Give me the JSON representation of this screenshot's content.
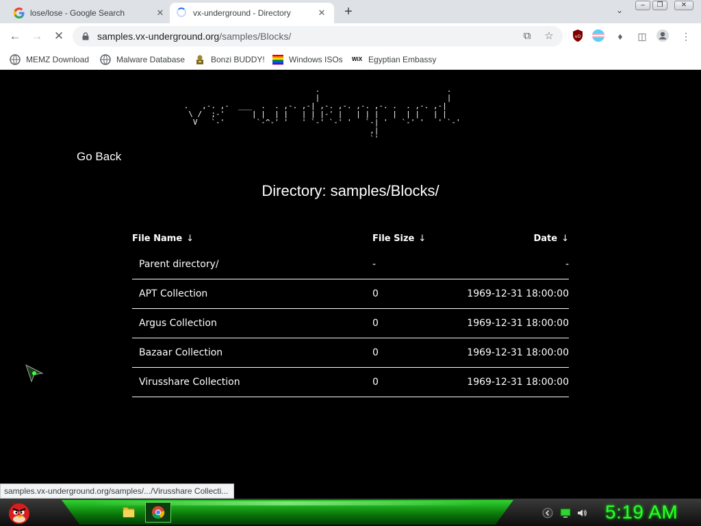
{
  "browser": {
    "tabs": [
      {
        "title": "lose/lose - Google Search",
        "active": false
      },
      {
        "title": "vx-underground - Directory",
        "active": true
      }
    ],
    "new_tab_symbol": "+",
    "address": {
      "host": "samples.vx-underground.org",
      "path": "/samples/Blocks/"
    },
    "bookmarks": [
      {
        "label": "MEMZ Download",
        "icon": "globe-icon"
      },
      {
        "label": "Malware Database",
        "icon": "globe-icon"
      },
      {
        "label": "Bonzi BUDDY!",
        "icon": "bonzi-icon"
      },
      {
        "label": "Windows ISOs",
        "icon": "rainbow-flag-icon"
      },
      {
        "label": "Egyptian Embassy",
        "icon": "wix-icon"
      }
    ],
    "wix_glyph": "WiX"
  },
  "page": {
    "ascii_logo": "                              .                            .\n                              |                            |\n .   ,-. ,-  ___  .  . ,-. ,-| ,-. ,-. ,-. ,-. .  . ,-. ,-|\n  \\ /  ;-'      | |  | |   | | |-' |   | | |   |  | |   | |\n   V   `-'       `-^-' '   ' `-' `-' '   `-| '   `-' '   ' `-'\n                                          ,|\n                                          `'",
    "go_back": "Go Back",
    "directory_title": "Directory: samples/Blocks/",
    "table": {
      "headers": {
        "name": "File Name",
        "size": "File Size",
        "date": "Date",
        "sort_arrow": "↓"
      },
      "rows": [
        {
          "name": "Parent directory/",
          "size": "-",
          "date": "-"
        },
        {
          "name": "APT Collection",
          "size": "0",
          "date": "1969-12-31 18:00:00"
        },
        {
          "name": "Argus Collection",
          "size": "0",
          "date": "1969-12-31 18:00:00"
        },
        {
          "name": "Bazaar Collection",
          "size": "0",
          "date": "1969-12-31 18:00:00"
        },
        {
          "name": "Virusshare Collection",
          "size": "0",
          "date": "1969-12-31 18:00:00"
        }
      ]
    }
  },
  "status_url": "samples.vx-underground.org/samples/.../Virusshare Collecti...",
  "taskbar": {
    "clock": "5:19 AM"
  },
  "colors": {
    "clock": "#2bff2b",
    "taskbar_glow": "#2fd52f",
    "page_background": "#000000"
  }
}
